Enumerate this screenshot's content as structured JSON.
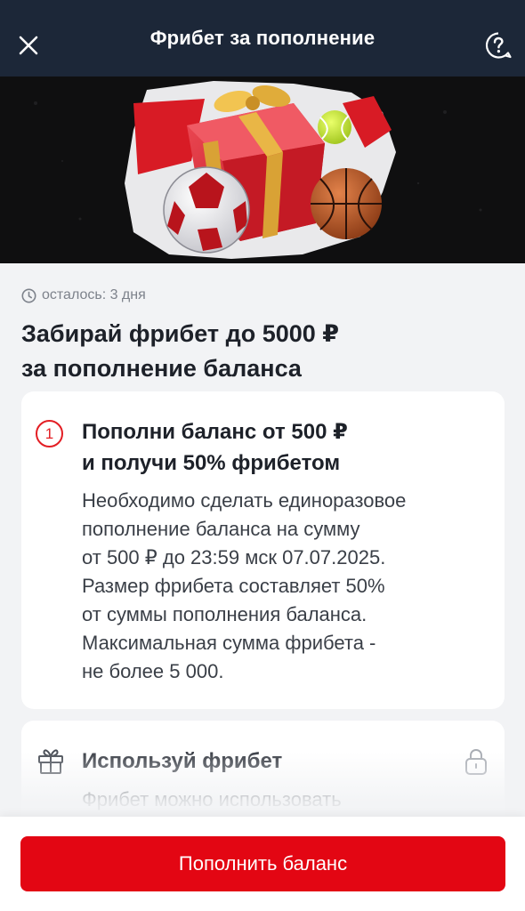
{
  "header": {
    "title": "Фрибет за пополнение",
    "close_icon": "close-icon",
    "help_icon": "help-icon"
  },
  "banner": {
    "image": "promo-banner-gift-and-balls"
  },
  "promo": {
    "remaining": "осталось: 3 дня",
    "headline": [
      "Забирай фрибет до 5000 ₽",
      "за пополнение баланса"
    ]
  },
  "steps": [
    {
      "number": "1",
      "title": [
        "Пополни баланс от 500 ₽",
        "и получи 50% фрибетом"
      ],
      "body": [
        "Необходимо сделать единоразовое",
        "пополнение баланса на сумму",
        "от 500 ₽ до 23:59 мск 07.07.2025.",
        "Размер фрибета составляет 50%",
        "от суммы пополнения баланса.",
        "Максимальная сумма фрибета -",
        "не более 5 000."
      ]
    },
    {
      "icon": "gift-icon",
      "title": "Используй фрибет",
      "body": "Фрибет можно использовать",
      "lock_icon": "lock-icon"
    }
  ],
  "cta": {
    "label": "Пополнить баланс"
  },
  "colors": {
    "header_bg": "#1c2738",
    "accent": "#e30613",
    "page_bg": "#f2f3f5"
  }
}
